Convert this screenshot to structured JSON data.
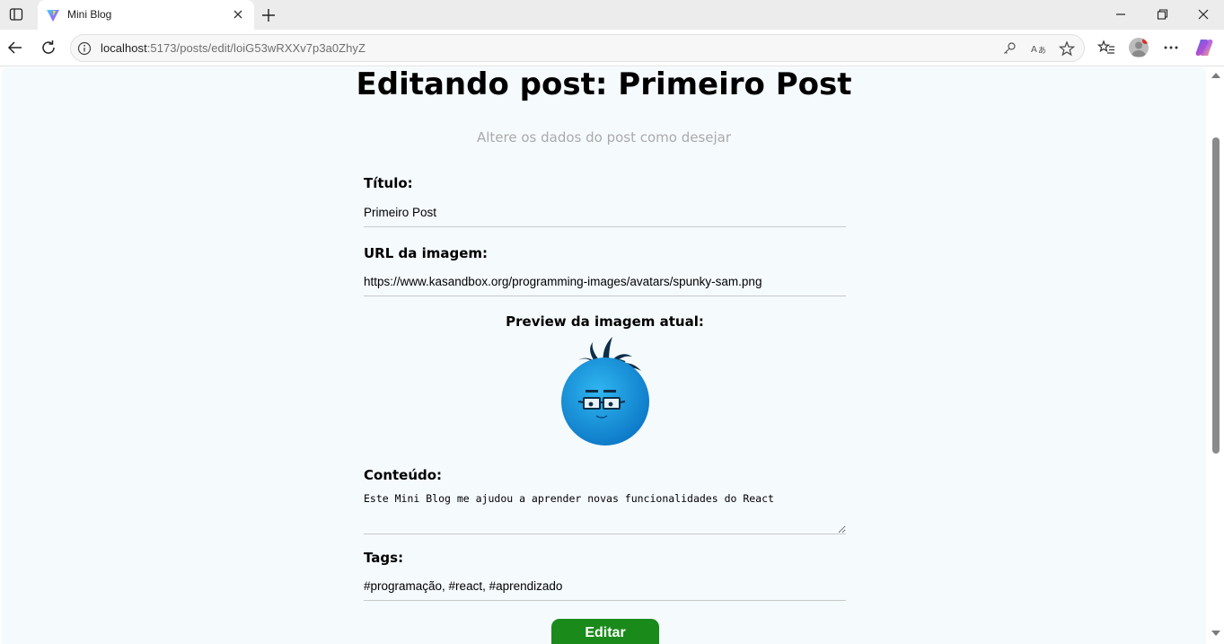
{
  "browser": {
    "tab": {
      "title": "Mini Blog"
    },
    "address": {
      "host": "localhost",
      "rest": ":5173/posts/edit/loiG53wRXXv7p3a0ZhyZ"
    }
  },
  "page": {
    "title": "Editando post: Primeiro Post",
    "subtitle": "Altere os dados do post como desejar"
  },
  "form": {
    "title": {
      "label": "Título:",
      "value": "Primeiro Post"
    },
    "image": {
      "label": "URL da imagem:",
      "value": "https://www.kasandbox.org/programming-images/avatars/spunky-sam.png"
    },
    "preview": {
      "label": "Preview da imagem atual:"
    },
    "content": {
      "label": "Conteúdo:",
      "value": "Este Mini Blog me ajudou a aprender novas funcionalidades do React"
    },
    "tags": {
      "label": "Tags:",
      "value": "#programação, #react, #aprendizado"
    },
    "submit_label": "Editar"
  },
  "colors": {
    "submit": "#1a8a1a",
    "page_bg": "#f5fafd",
    "subtitle": "#aaaaaa"
  },
  "icons": [
    "sidebar-icon",
    "vite-logo-icon",
    "close-icon",
    "plus-icon",
    "minimize-icon",
    "restore-icon",
    "back-arrow-icon",
    "reload-icon",
    "info-icon",
    "key-icon",
    "translate-icon",
    "star-icon",
    "favorites-icon",
    "profile-avatar-icon",
    "more-icon",
    "copilot-icon"
  ]
}
